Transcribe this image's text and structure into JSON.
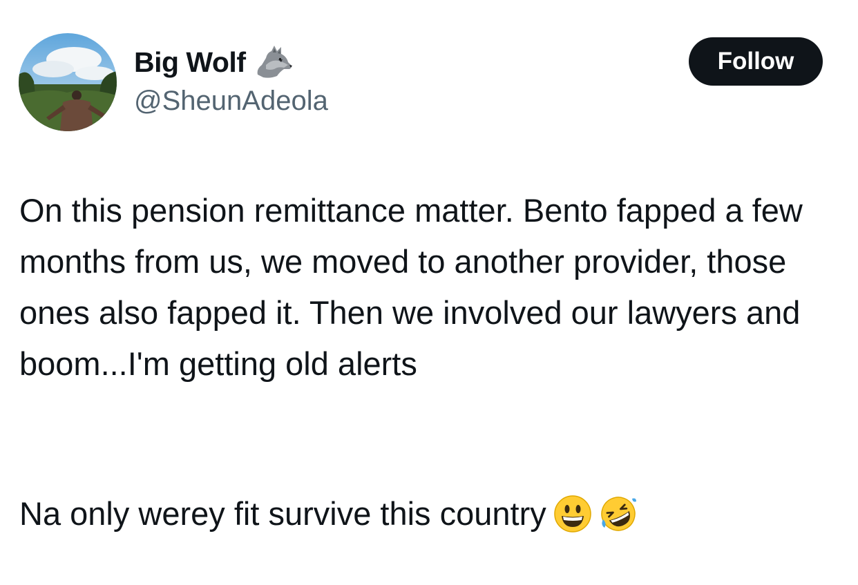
{
  "author": {
    "display_name": "Big Wolf",
    "badge_icon": "wolf-icon",
    "handle": "@SheunAdeola",
    "avatar_icon": "avatar-photo"
  },
  "actions": {
    "follow_label": "Follow"
  },
  "tweet": {
    "paragraph1": "On this pension remittance matter. Bento fapped a few months from us, we moved to another provider, those ones also fapped it. Then we involved our lawyers and boom...I'm getting old alerts",
    "paragraph2": "Na only werey fit survive this country",
    "emojis": [
      "grinning-face-icon",
      "rolling-on-floor-laughing-icon"
    ]
  },
  "colors": {
    "text": "#0f1419",
    "secondary_text": "#536471",
    "button_bg": "#0f1419",
    "button_text": "#ffffff",
    "background": "#ffffff"
  }
}
